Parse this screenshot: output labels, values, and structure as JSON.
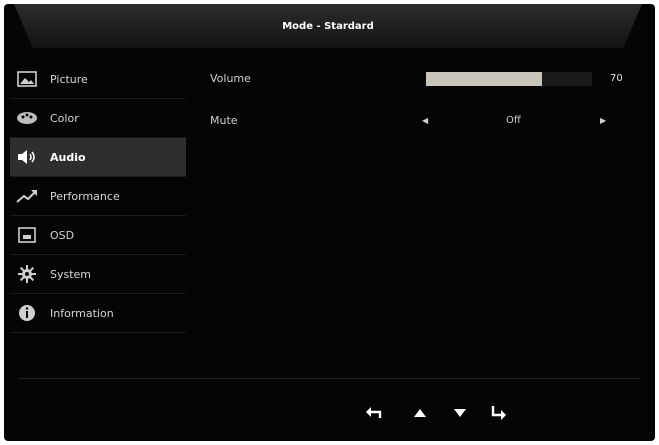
{
  "header": {
    "title": "Mode - Stardard"
  },
  "sidebar": {
    "items": [
      {
        "label": "Picture",
        "icon": "picture-icon"
      },
      {
        "label": "Color",
        "icon": "color-palette-icon"
      },
      {
        "label": "Audio",
        "icon": "speaker-icon",
        "active": true
      },
      {
        "label": "Performance",
        "icon": "trend-up-icon"
      },
      {
        "label": "OSD",
        "icon": "osd-window-icon"
      },
      {
        "label": "System",
        "icon": "gear-icon"
      },
      {
        "label": "Information",
        "icon": "info-icon"
      }
    ]
  },
  "audio": {
    "volume": {
      "label": "Volume",
      "value": "70",
      "level_percent": 70
    },
    "mute": {
      "label": "Mute",
      "value": "Off"
    }
  },
  "nav": {
    "icons": [
      "back-icon",
      "up-arrow-icon",
      "down-arrow-icon",
      "enter-icon"
    ]
  },
  "colors": {
    "background": "#050505",
    "active_item": "#2e2e2e",
    "slider_fill": "#c8c6ba"
  }
}
